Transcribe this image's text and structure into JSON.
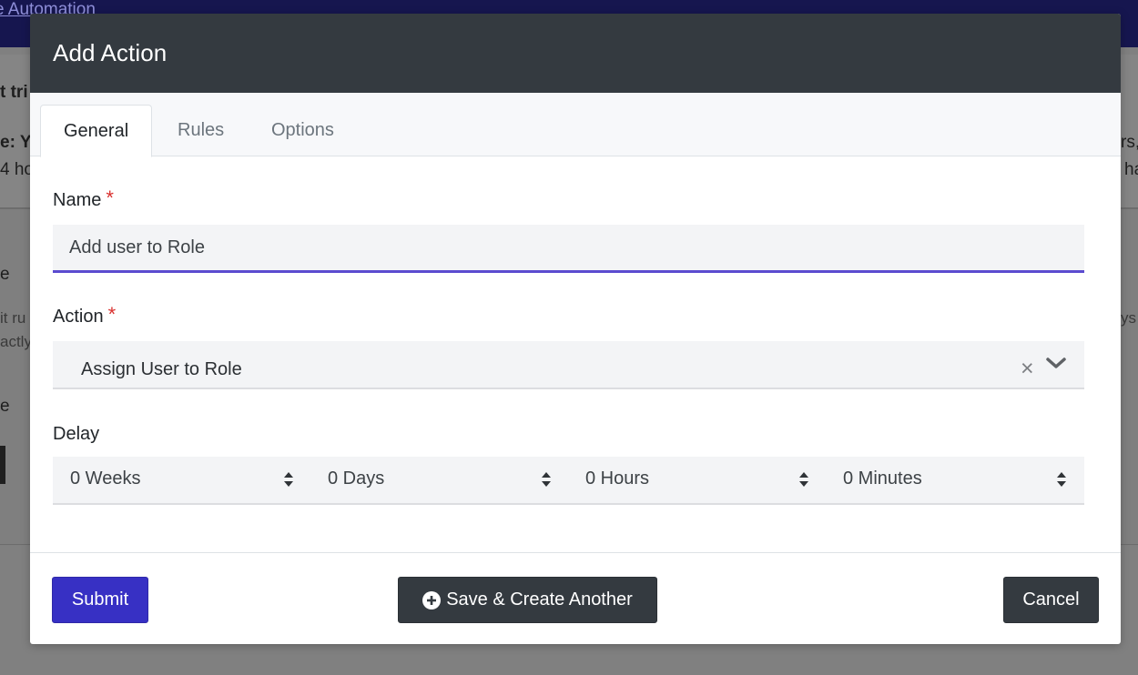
{
  "background": {
    "topbar_link": "e Automation",
    "panel_text_1": "t tri",
    "panel_text_2": "e: Y",
    "panel_text_3": "4 ho",
    "panel_text_right_1": "rs,",
    "panel_text_right_2": "ha",
    "section_text_1": "e",
    "section_text_2": "it ru",
    "section_text_3": "actly",
    "section_text_right": "ys",
    "section_text_4": "e"
  },
  "modal": {
    "title": "Add Action",
    "tabs": [
      {
        "label": "General",
        "active": true
      },
      {
        "label": "Rules",
        "active": false
      },
      {
        "label": "Options",
        "active": false
      }
    ],
    "name_field": {
      "label": "Name",
      "required_mark": "*",
      "value": "Add user to Role"
    },
    "action_field": {
      "label": "Action",
      "required_mark": "*",
      "selected": "Assign User to Role",
      "clear_glyph": "×"
    },
    "delay_field": {
      "label": "Delay",
      "weeks": "0 Weeks",
      "days": "0 Days",
      "hours": "0 Hours",
      "minutes": "0 Minutes"
    },
    "footer": {
      "submit_label": "Submit",
      "save_another_label": "Save & Create Another",
      "cancel_label": "Cancel"
    }
  },
  "colors": {
    "accent": "#3730c4",
    "input_focus_border": "#5b4bcf",
    "header_bg": "#343a40",
    "required": "#d9312f"
  },
  "icons": {
    "clear": "close-icon",
    "dropdown": "chevron-down-icon",
    "sort": "sort-icon",
    "plus": "plus-circle-icon"
  }
}
